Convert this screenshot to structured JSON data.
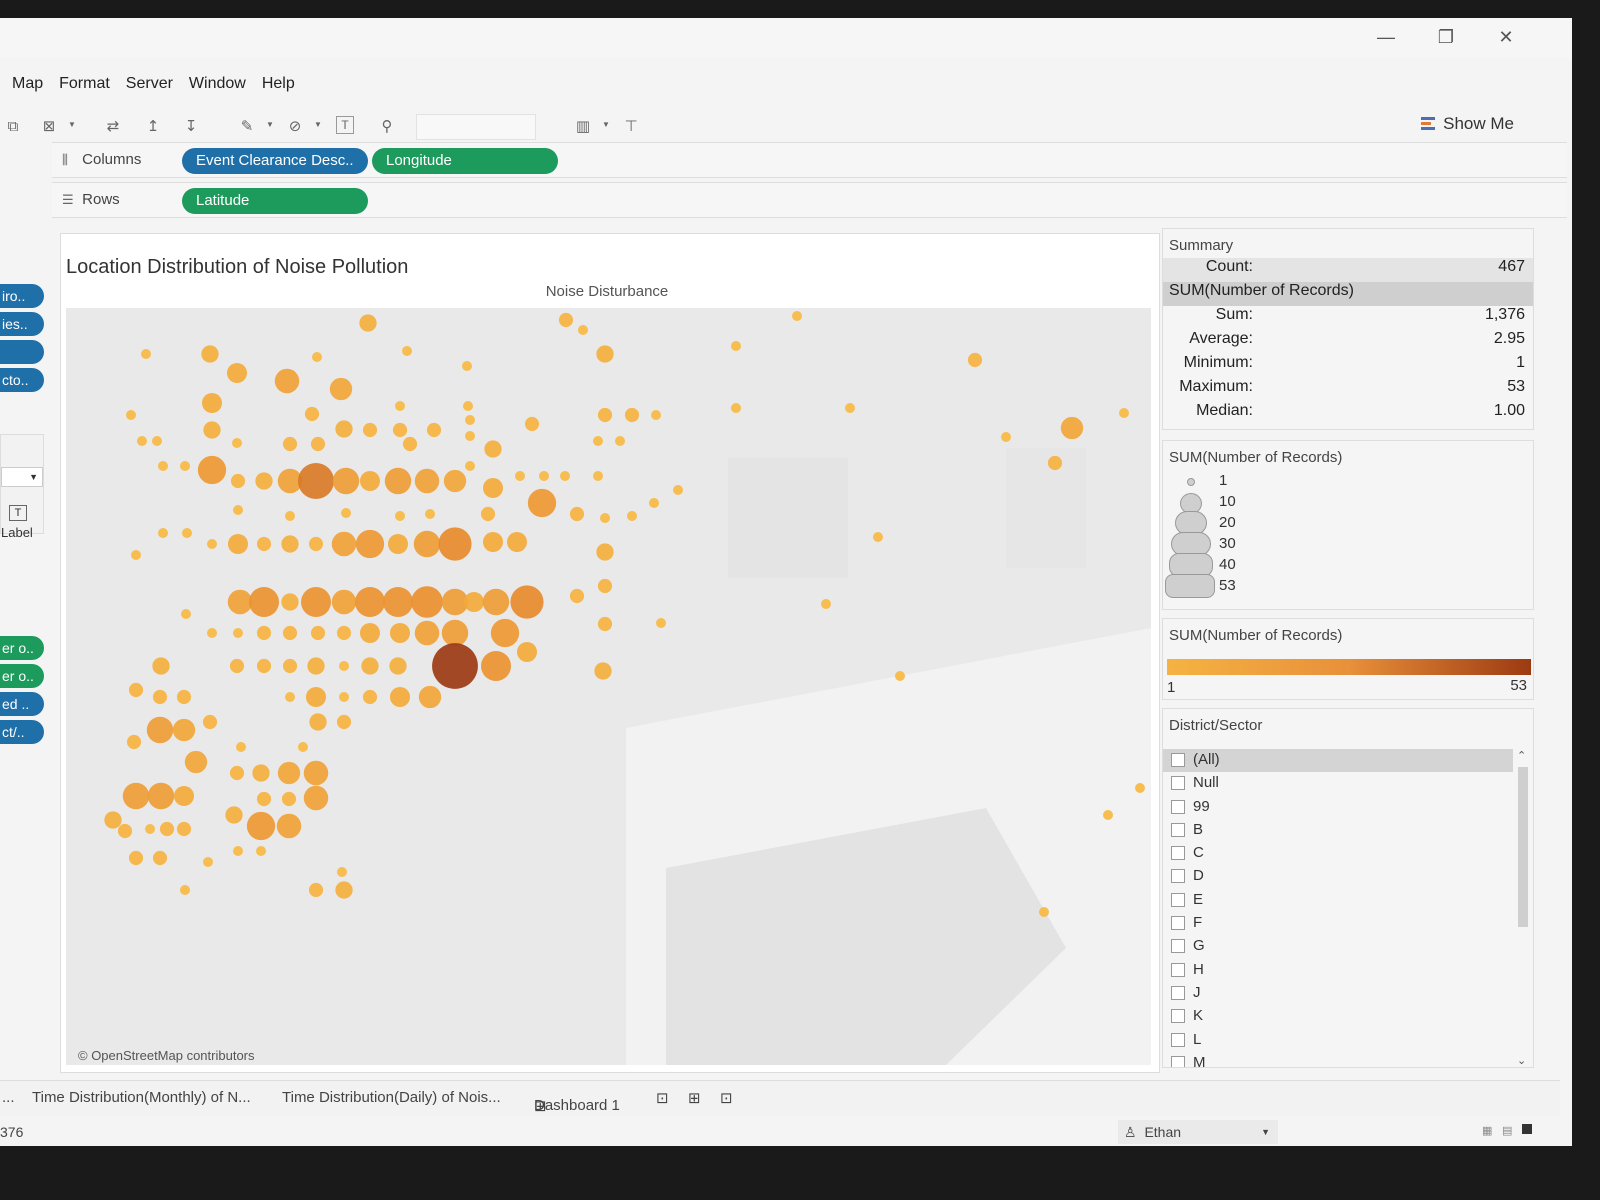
{
  "window": {
    "minimize": "—",
    "restore": "❐",
    "close": "✕"
  },
  "menu": [
    "Map",
    "Format",
    "Server",
    "Window",
    "Help"
  ],
  "toolbar": {
    "show_me": "Show Me"
  },
  "shelves": {
    "columns_label": "Columns",
    "rows_label": "Rows",
    "columns": [
      "Event Clearance Desc..",
      "Longitude"
    ],
    "rows": [
      "Latitude"
    ]
  },
  "left_panel": {
    "pills_top": [
      "iro..",
      "ies..",
      "",
      "cto.."
    ],
    "label_card": "Label",
    "pills_bottom": [
      "er o..",
      "er o..",
      "ed ..",
      "ct/.."
    ]
  },
  "view": {
    "title": "Location Distribution of Noise Pollution",
    "pane_header": "Noise Disturbance",
    "attribution": "© OpenStreetMap contributors"
  },
  "summary": {
    "title": "Summary",
    "count_label": "Count:",
    "count_value": "467",
    "measure": "SUM(Number of Records)",
    "sum_label": "Sum:",
    "sum_value": "1,376",
    "avg_label": "Average:",
    "avg_value": "2.95",
    "min_label": "Minimum:",
    "min_value": "1",
    "max_label": "Maximum:",
    "max_value": "53",
    "median_label": "Median:",
    "median_value": "1.00"
  },
  "size_legend": {
    "title": "SUM(Number of Records)",
    "items": [
      "1",
      "10",
      "20",
      "30",
      "40",
      "53"
    ]
  },
  "color_legend": {
    "title": "SUM(Number of Records)",
    "min": "1",
    "max": "53",
    "color_low": "#f5b342",
    "color_high": "#9c3a12"
  },
  "filter": {
    "title": "District/Sector",
    "items": [
      "(All)",
      "Null",
      "99",
      "B",
      "C",
      "D",
      "E",
      "F",
      "G",
      "H",
      "J",
      "K",
      "L",
      "M"
    ]
  },
  "tabs": {
    "first": "...",
    "monthly": "Time Distribution(Monthly) of N...",
    "daily": "Time Distribution(Daily) of Nois...",
    "dashboard": "Dashboard 1"
  },
  "status": {
    "left": "376",
    "user": "Ethan"
  },
  "map_marks": [
    [
      231,
      303,
      1
    ],
    [
      368,
      323,
      3
    ],
    [
      284,
      296,
      1
    ],
    [
      566,
      320,
      2
    ],
    [
      583,
      330,
      1
    ],
    [
      605,
      354,
      3
    ],
    [
      797,
      316,
      1
    ],
    [
      736,
      346,
      1
    ],
    [
      975,
      360,
      2
    ],
    [
      146,
      354,
      1
    ],
    [
      210,
      354,
      3
    ],
    [
      237,
      373,
      4
    ],
    [
      287,
      381,
      6
    ],
    [
      317,
      357,
      1
    ],
    [
      341,
      389,
      5
    ],
    [
      407,
      351,
      1
    ],
    [
      467,
      366,
      1
    ],
    [
      212,
      403,
      4
    ],
    [
      131,
      415,
      1
    ],
    [
      312,
      414,
      2
    ],
    [
      400,
      406,
      1
    ],
    [
      468,
      406,
      1
    ],
    [
      470,
      420,
      1
    ],
    [
      605,
      415,
      2
    ],
    [
      632,
      415,
      2
    ],
    [
      656,
      415,
      1
    ],
    [
      736,
      408,
      1
    ],
    [
      850,
      408,
      1
    ],
    [
      1072,
      428,
      5
    ],
    [
      1055,
      463,
      2
    ],
    [
      1006,
      437,
      1
    ],
    [
      1124,
      413,
      1
    ],
    [
      142,
      441,
      1
    ],
    [
      157,
      441,
      1
    ],
    [
      212,
      430,
      3
    ],
    [
      237,
      443,
      1
    ],
    [
      290,
      444,
      2
    ],
    [
      318,
      444,
      2
    ],
    [
      344,
      429,
      3
    ],
    [
      370,
      430,
      2
    ],
    [
      400,
      430,
      2
    ],
    [
      434,
      430,
      2
    ],
    [
      410,
      444,
      2
    ],
    [
      470,
      436,
      1
    ],
    [
      493,
      449,
      3
    ],
    [
      532,
      424,
      2
    ],
    [
      598,
      441,
      1
    ],
    [
      620,
      441,
      1
    ],
    [
      212,
      470,
      8
    ],
    [
      163,
      466,
      1
    ],
    [
      185,
      466,
      1
    ],
    [
      238,
      481,
      2
    ],
    [
      264,
      481,
      3
    ],
    [
      290,
      481,
      6
    ],
    [
      316,
      481,
      13
    ],
    [
      346,
      481,
      7
    ],
    [
      370,
      481,
      4
    ],
    [
      398,
      481,
      7
    ],
    [
      427,
      481,
      6
    ],
    [
      455,
      481,
      5
    ],
    [
      493,
      488,
      4
    ],
    [
      542,
      503,
      8
    ],
    [
      470,
      466,
      1
    ],
    [
      520,
      476,
      1
    ],
    [
      544,
      476,
      1
    ],
    [
      565,
      476,
      1
    ],
    [
      598,
      476,
      1
    ],
    [
      678,
      490,
      1
    ],
    [
      163,
      533,
      1
    ],
    [
      187,
      533,
      1
    ],
    [
      212,
      544,
      1
    ],
    [
      238,
      544,
      4
    ],
    [
      264,
      544,
      2
    ],
    [
      290,
      544,
      3
    ],
    [
      316,
      544,
      2
    ],
    [
      344,
      544,
      6
    ],
    [
      370,
      544,
      8
    ],
    [
      398,
      544,
      4
    ],
    [
      427,
      544,
      7
    ],
    [
      455,
      544,
      11
    ],
    [
      493,
      542,
      4
    ],
    [
      517,
      542,
      4
    ],
    [
      577,
      514,
      2
    ],
    [
      605,
      518,
      1
    ],
    [
      632,
      516,
      1
    ],
    [
      654,
      503,
      1
    ],
    [
      136,
      555,
      1
    ],
    [
      238,
      510,
      1
    ],
    [
      290,
      516,
      1
    ],
    [
      346,
      513,
      1
    ],
    [
      400,
      516,
      1
    ],
    [
      430,
      514,
      1
    ],
    [
      488,
      514,
      2
    ],
    [
      605,
      552,
      3
    ],
    [
      240,
      602,
      6
    ],
    [
      264,
      602,
      9
    ],
    [
      290,
      602,
      3
    ],
    [
      316,
      602,
      9
    ],
    [
      344,
      602,
      6
    ],
    [
      370,
      602,
      9
    ],
    [
      398,
      602,
      9
    ],
    [
      427,
      602,
      10
    ],
    [
      455,
      602,
      7
    ],
    [
      474,
      602,
      4
    ],
    [
      496,
      602,
      7
    ],
    [
      527,
      602,
      11
    ],
    [
      577,
      596,
      2
    ],
    [
      605,
      586,
      2
    ],
    [
      605,
      624,
      2
    ],
    [
      186,
      614,
      1
    ],
    [
      212,
      633,
      1
    ],
    [
      238,
      633,
      1
    ],
    [
      264,
      633,
      2
    ],
    [
      290,
      633,
      2
    ],
    [
      318,
      633,
      2
    ],
    [
      344,
      633,
      2
    ],
    [
      370,
      633,
      4
    ],
    [
      400,
      633,
      4
    ],
    [
      427,
      633,
      6
    ],
    [
      455,
      633,
      7
    ],
    [
      505,
      633,
      8
    ],
    [
      161,
      666,
      3
    ],
    [
      237,
      666,
      2
    ],
    [
      264,
      666,
      2
    ],
    [
      290,
      666,
      2
    ],
    [
      316,
      666,
      3
    ],
    [
      344,
      666,
      1
    ],
    [
      370,
      666,
      3
    ],
    [
      398,
      666,
      3
    ],
    [
      455,
      666,
      21
    ],
    [
      496,
      666,
      9
    ],
    [
      527,
      652,
      4
    ],
    [
      603,
      671,
      3
    ],
    [
      661,
      623,
      1
    ],
    [
      136,
      690,
      2
    ],
    [
      160,
      697,
      2
    ],
    [
      184,
      697,
      2
    ],
    [
      290,
      697,
      1
    ],
    [
      316,
      697,
      4
    ],
    [
      344,
      697,
      1
    ],
    [
      370,
      697,
      2
    ],
    [
      400,
      697,
      4
    ],
    [
      430,
      697,
      5
    ],
    [
      160,
      730,
      7
    ],
    [
      184,
      730,
      5
    ],
    [
      134,
      742,
      2
    ],
    [
      210,
      722,
      2
    ],
    [
      318,
      722,
      3
    ],
    [
      344,
      722,
      2
    ],
    [
      196,
      762,
      5
    ],
    [
      237,
      773,
      2
    ],
    [
      261,
      773,
      3
    ],
    [
      289,
      773,
      5
    ],
    [
      316,
      773,
      6
    ],
    [
      303,
      747,
      1
    ],
    [
      241,
      747,
      1
    ],
    [
      136,
      796,
      7
    ],
    [
      161,
      796,
      7
    ],
    [
      184,
      796,
      4
    ],
    [
      113,
      820,
      3
    ],
    [
      125,
      831,
      2
    ],
    [
      150,
      829,
      1
    ],
    [
      167,
      829,
      2
    ],
    [
      184,
      829,
      2
    ],
    [
      234,
      815,
      3
    ],
    [
      261,
      826,
      8
    ],
    [
      289,
      826,
      6
    ],
    [
      316,
      798,
      6
    ],
    [
      264,
      799,
      2
    ],
    [
      289,
      799,
      2
    ],
    [
      136,
      858,
      2
    ],
    [
      160,
      858,
      2
    ],
    [
      208,
      862,
      1
    ],
    [
      238,
      851,
      1
    ],
    [
      261,
      851,
      1
    ],
    [
      316,
      890,
      2
    ],
    [
      344,
      890,
      3
    ],
    [
      185,
      890,
      1
    ],
    [
      342,
      872,
      1
    ],
    [
      878,
      537,
      1
    ],
    [
      826,
      604,
      1
    ],
    [
      900,
      676,
      1
    ],
    [
      1140,
      788,
      1
    ],
    [
      1108,
      815,
      1
    ],
    [
      1044,
      912,
      1
    ]
  ]
}
